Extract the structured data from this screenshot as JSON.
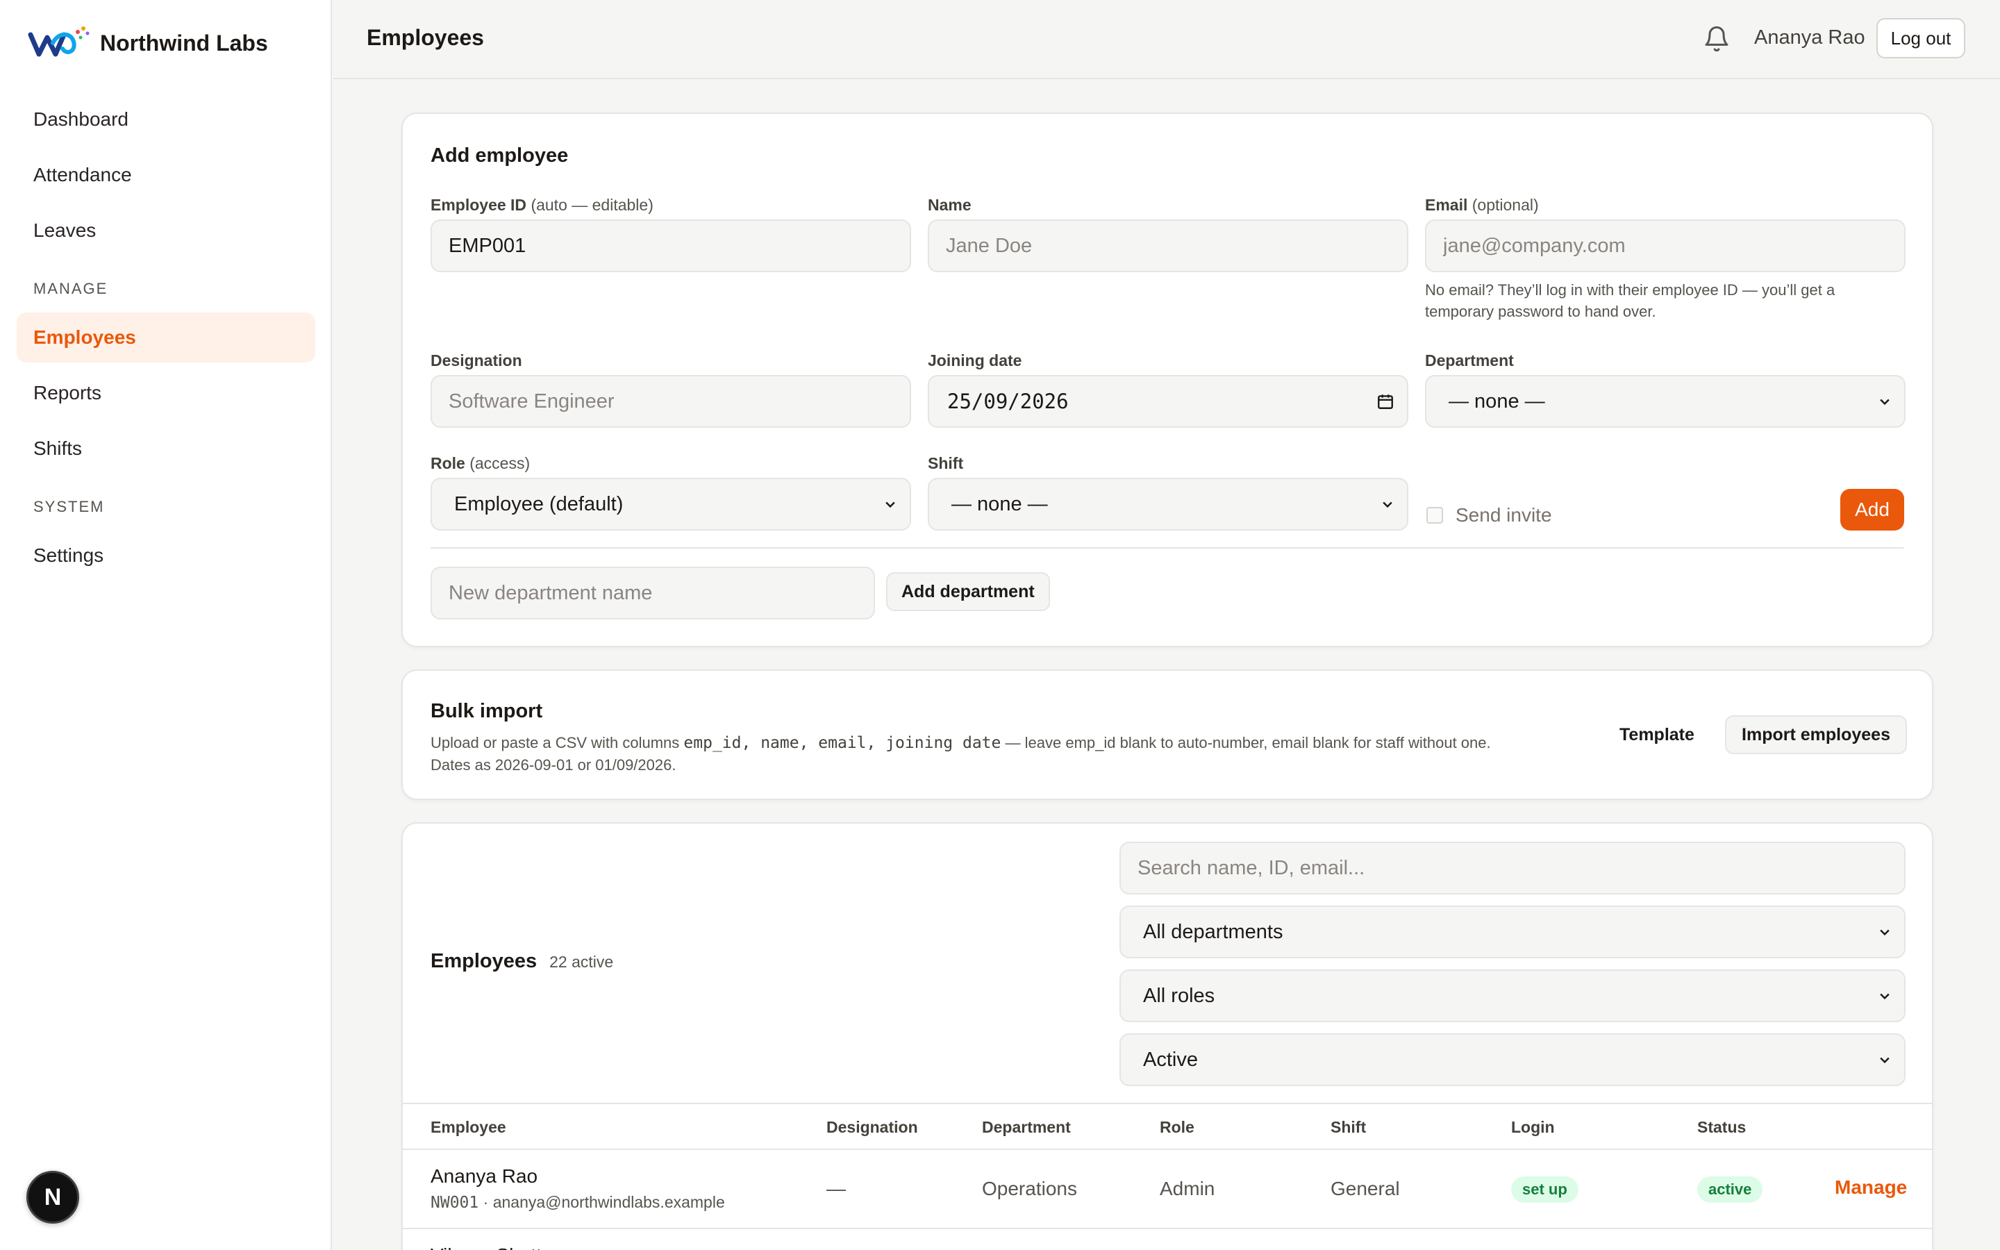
{
  "brand": {
    "name": "Northwind Labs",
    "logo_icon": "northwind-wave-logo"
  },
  "sidebar": {
    "items": [
      {
        "label": "Dashboard"
      },
      {
        "label": "Attendance"
      },
      {
        "label": "Leaves"
      }
    ],
    "sections": [
      {
        "title": "MANAGE",
        "items": [
          {
            "label": "Employees",
            "active": true
          },
          {
            "label": "Reports"
          },
          {
            "label": "Shifts"
          }
        ]
      },
      {
        "title": "SYSTEM",
        "items": [
          {
            "label": "Settings"
          }
        ]
      }
    ],
    "badge": "N"
  },
  "header": {
    "title": "Employees",
    "notification_icon": "bell-icon",
    "user_name": "Ananya Rao",
    "logout_label": "Log out"
  },
  "add_employee": {
    "title": "Add employee",
    "employee_id": {
      "label": "Employee ID",
      "hint": "(auto — editable)",
      "value": "EMP001"
    },
    "name": {
      "label": "Name",
      "placeholder": "Jane Doe"
    },
    "email": {
      "label": "Email",
      "hint": "(optional)",
      "placeholder": "jane@company.com",
      "helper": "No email? They’ll log in with their employee ID — you’ll get a temporary password to hand over."
    },
    "designation": {
      "label": "Designation",
      "placeholder": "Software Engineer"
    },
    "joining_date": {
      "label": "Joining date",
      "value": "25/09/2026"
    },
    "department": {
      "label": "Department",
      "value": "— none —"
    },
    "role": {
      "label": "Role",
      "hint": "(access)",
      "value": "Employee (default)"
    },
    "shift": {
      "label": "Shift",
      "value": "— none —"
    },
    "send_invite_label": "Send invite",
    "send_invite_checked": false,
    "add_label": "Add",
    "new_department_placeholder": "New department name",
    "add_department_label": "Add department"
  },
  "bulk_import": {
    "title": "Bulk import",
    "desc_prefix": "Upload or paste a CSV with columns",
    "desc_columns": "emp_id, name, email, joining date",
    "desc_suffix": "— leave emp_id blank to auto-number, email blank for staff without one.",
    "desc_line2": "Dates as 2026-09-01 or 01/09/2026.",
    "template_label": "Template",
    "import_label": "Import employees"
  },
  "employees": {
    "title": "Employees",
    "count_label": "22 active",
    "search_placeholder": "Search name, ID, email...",
    "filters": {
      "department": "All departments",
      "role": "All roles",
      "status": "Active"
    },
    "columns": [
      "Employee",
      "Designation",
      "Department",
      "Role",
      "Shift",
      "Login",
      "Status"
    ],
    "rows": [
      {
        "name": "Ananya Rao",
        "id": "NW001",
        "email": "ananya@northwindlabs.example",
        "designation": "—",
        "department": "Operations",
        "role": "Admin",
        "shift": "General",
        "login": "set up",
        "status": "active",
        "action": "Manage"
      },
      {
        "name": "Vikram Shetty"
      }
    ]
  },
  "colors": {
    "accent": "#ea580c",
    "accent_soft": "#fff1e8",
    "success_bg": "#dcfce7",
    "success_text": "#15803d"
  }
}
